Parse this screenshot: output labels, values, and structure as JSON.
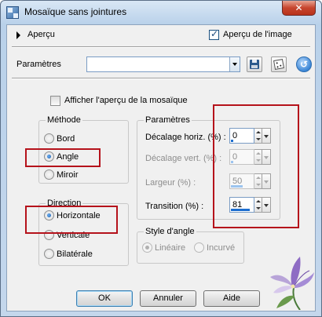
{
  "window": {
    "title": "Mosaïque sans jointures",
    "close_label": "✕"
  },
  "preview": {
    "label": "Aperçu",
    "image_preview_label": "Aperçu de l'image",
    "image_preview_checked": true
  },
  "presets": {
    "label": "Paramètres",
    "value": ""
  },
  "show_tile_preview": {
    "label": "Afficher l'aperçu de la mosaïque",
    "checked": false
  },
  "method": {
    "title": "Méthode",
    "options": [
      {
        "label": "Bord",
        "selected": false
      },
      {
        "label": "Angle",
        "selected": true
      },
      {
        "label": "Miroir",
        "selected": false
      }
    ]
  },
  "direction": {
    "title": "Direction",
    "options": [
      {
        "label": "Horizontale",
        "selected": true
      },
      {
        "label": "Verticale",
        "selected": false
      },
      {
        "label": "Bilatérale",
        "selected": false
      }
    ]
  },
  "settings": {
    "title": "Paramètres",
    "fields": [
      {
        "label": "Décalage horiz. (%) :",
        "value": "0",
        "level": 0.0,
        "enabled": true
      },
      {
        "label": "Décalage vert. (%) :",
        "value": "0",
        "level": 0.0,
        "enabled": false
      },
      {
        "label": "Largeur (%) :",
        "value": "50",
        "level": 0.5,
        "enabled": false
      },
      {
        "label": "Transition (%) :",
        "value": "81",
        "level": 0.81,
        "enabled": true
      }
    ]
  },
  "corner_style": {
    "title": "Style d'angle",
    "options": [
      {
        "label": "Linéaire",
        "selected": true,
        "enabled": false
      },
      {
        "label": "Incurvé",
        "selected": false,
        "enabled": false
      }
    ]
  },
  "buttons": {
    "ok": "OK",
    "cancel": "Annuler",
    "help": "Aide"
  },
  "colors": {
    "highlight": "#b5121b",
    "accent": "#1c6ed0"
  },
  "icons": [
    "app-icon",
    "close-icon",
    "expand-arrow-icon",
    "save-preset-icon",
    "randomize-icon",
    "reset-icon",
    "flower-logo-icon"
  ]
}
